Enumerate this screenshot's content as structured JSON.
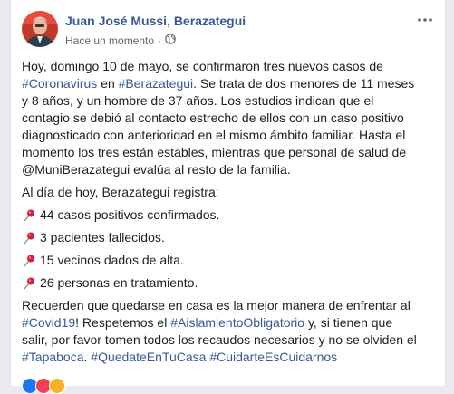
{
  "post": {
    "author": "Juan José Mussi, Berazategui",
    "timestamp": "Hace un momento",
    "privacy_icon": "globe-icon",
    "more_icon": "more-options-icon",
    "paragraph1": {
      "t1": "Hoy, domingo 10 de mayo, se confirmaron tres nuevos casos de ",
      "tag1": "#Coronavirus",
      "t2": " en ",
      "tag2": "#Berazategui",
      "t3": ". Se trata de dos menores de 11 meses y 8 años, y un hombre de 37 años. Los estudios indican que el contagio se debió al contacto estrecho de ellos con un caso positivo diagnosticado con anterioridad en el mismo ámbito familiar. Hasta el momento los tres están estables, mientras que personal de salud de @MuniBerazategui evalúa al resto de la familia."
    },
    "intro": "Al día de hoy, Berazategui registra:",
    "items": [
      "44 casos positivos confirmados.",
      "3 pacientes fallecidos.",
      "15 vecinos dados de alta.",
      "26 personas en tratamiento."
    ],
    "paragraph3": {
      "t1": "Recuerden que quedarse en casa es la mejor manera de enfrentar al ",
      "tag1": "#Covid19",
      "t2": "! Respetemos el ",
      "tag2": "#AislamientoObligatorio",
      "t3": " y, si tienen que salir, por favor tomen todos los recaudos necesarios y no se olviden el ",
      "tag3": "#Tapaboca",
      "t4": ". ",
      "tag4": "#QuedateEnTuCasa",
      "t5": " ",
      "tag5": "#CuidarteEsCuidarnos"
    }
  },
  "colors": {
    "link": "#385898",
    "pin": "#d21f3c",
    "like": "#1877f2",
    "love": "#f33e58",
    "haha": "#f7b125"
  }
}
